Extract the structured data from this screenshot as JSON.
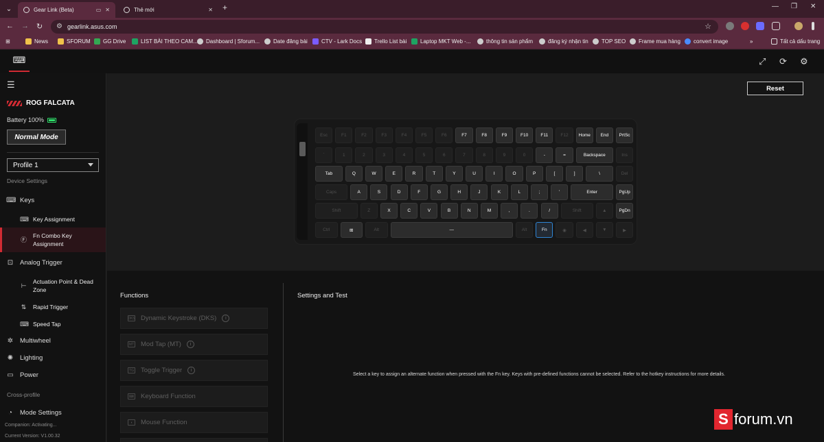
{
  "browser": {
    "tabs": [
      {
        "label": "Gear Link (Beta)",
        "active": true
      },
      {
        "label": "Thẻ mới",
        "active": false
      }
    ],
    "url": "gearlink.asus.com",
    "bookmarks": [
      {
        "label": "News",
        "color": "#f0c24a"
      },
      {
        "label": "SFORUM",
        "color": "#f0c24a"
      },
      {
        "label": "GG Drive",
        "color": "#34a853"
      },
      {
        "label": "LIST BÀI THEO CAM...",
        "color": "#1ea362"
      },
      {
        "label": "Dashboard | Sforum...",
        "color": "#cccccc"
      },
      {
        "label": "Date đăng bài",
        "color": "#cccccc"
      },
      {
        "label": "CTV - Lark Docs",
        "color": "#7b5cff"
      },
      {
        "label": "Trello List bài",
        "color": "#eeeeee"
      },
      {
        "label": "Laptop MKT Web -...",
        "color": "#1ea362"
      },
      {
        "label": "thông tin sản phẩm",
        "color": "#cccccc"
      },
      {
        "label": "đăng ký nhận tin",
        "color": "#cccccc"
      },
      {
        "label": "TOP SEO",
        "color": "#cccccc"
      },
      {
        "label": "Frame mua hàng",
        "color": "#cccccc"
      },
      {
        "label": "convert image",
        "color": "#4a8cff"
      }
    ],
    "all_bookmarks": "Tất cả dấu trang"
  },
  "sidebar": {
    "device_name": "ROG FALCATA",
    "battery": "Battery 100%",
    "mode": "Normal Mode",
    "profile": "Profile 1",
    "device_settings": "Device Settings",
    "keys": "Keys",
    "key_assignment": "Key Assignment",
    "fn_combo_1": "Fn Combo Key",
    "fn_combo_2": "Assignment",
    "analog_trigger": "Analog Trigger",
    "actuation_1": "Actuation Point & Dead",
    "actuation_2": "Zone",
    "rapid_trigger": "Rapid Trigger",
    "speed_tap": "Speed Tap",
    "multiwheel": "Multiwheel",
    "lighting": "Lighting",
    "power": "Power",
    "cross_profile": "Cross-profile",
    "mode_settings": "Mode Settings",
    "companion": "Companion: Activating...",
    "version": "Current Version: V1.00.32"
  },
  "main": {
    "reset": "Reset",
    "keyboard": {
      "row1": [
        {
          "l": "Esc",
          "on": false
        },
        {
          "l": "F1",
          "on": false
        },
        {
          "l": "F2",
          "on": false
        },
        {
          "l": "F3",
          "on": false
        },
        {
          "l": "F4",
          "on": false
        },
        {
          "l": "F5",
          "on": false
        },
        {
          "l": "F6",
          "on": false
        },
        {
          "l": "F7",
          "on": true
        },
        {
          "l": "F8",
          "on": true
        },
        {
          "l": "F9",
          "on": true
        },
        {
          "l": "F10",
          "on": true
        },
        {
          "l": "F11",
          "on": true
        },
        {
          "l": "F12",
          "on": false
        },
        {
          "l": "Home",
          "on": true
        },
        {
          "l": "End",
          "on": true
        },
        {
          "l": "PrtSc",
          "on": true
        }
      ],
      "row2": [
        {
          "l": "`",
          "on": false
        },
        {
          "l": "1",
          "on": false
        },
        {
          "l": "2",
          "on": false
        },
        {
          "l": "3",
          "on": false
        },
        {
          "l": "4",
          "on": false
        },
        {
          "l": "5",
          "on": false
        },
        {
          "l": "6",
          "on": false
        },
        {
          "l": "7",
          "on": false
        },
        {
          "l": "8",
          "on": false
        },
        {
          "l": "9",
          "on": false
        },
        {
          "l": "0",
          "on": false
        },
        {
          "l": "-",
          "on": true
        },
        {
          "l": "=",
          "on": true
        },
        {
          "l": "Backspace",
          "on": true
        },
        {
          "l": "Ins",
          "on": false
        }
      ],
      "row3": [
        {
          "l": "Tab",
          "on": true
        },
        {
          "l": "Q",
          "on": true
        },
        {
          "l": "W",
          "on": true
        },
        {
          "l": "E",
          "on": true
        },
        {
          "l": "R",
          "on": true
        },
        {
          "l": "T",
          "on": true
        },
        {
          "l": "Y",
          "on": true
        },
        {
          "l": "U",
          "on": true
        },
        {
          "l": "I",
          "on": true
        },
        {
          "l": "O",
          "on": true
        },
        {
          "l": "P",
          "on": true
        },
        {
          "l": "[",
          "on": true
        },
        {
          "l": "]",
          "on": true
        },
        {
          "l": "\\",
          "on": true
        },
        {
          "l": "Del",
          "on": false
        }
      ],
      "row4": [
        {
          "l": "Caps",
          "on": false
        },
        {
          "l": "A",
          "on": true
        },
        {
          "l": "S",
          "on": true
        },
        {
          "l": "D",
          "on": true
        },
        {
          "l": "F",
          "on": true
        },
        {
          "l": "G",
          "on": true
        },
        {
          "l": "H",
          "on": true
        },
        {
          "l": "J",
          "on": true
        },
        {
          "l": "K",
          "on": true
        },
        {
          "l": "L",
          "on": true
        },
        {
          "l": ";",
          "on": true
        },
        {
          "l": "'",
          "on": true
        },
        {
          "l": "Enter",
          "on": true
        },
        {
          "l": "PgUp",
          "on": true
        }
      ],
      "row5": [
        {
          "l": "Shift",
          "on": false
        },
        {
          "l": "Z",
          "on": false
        },
        {
          "l": "X",
          "on": true
        },
        {
          "l": "C",
          "on": true
        },
        {
          "l": "V",
          "on": true
        },
        {
          "l": "B",
          "on": true
        },
        {
          "l": "N",
          "on": true
        },
        {
          "l": "M",
          "on": true
        },
        {
          "l": ",",
          "on": true
        },
        {
          "l": ".",
          "on": true
        },
        {
          "l": "/",
          "on": true
        },
        {
          "l": "Shift",
          "on": false
        },
        {
          "l": "▲",
          "on": false
        },
        {
          "l": "PgDn",
          "on": true
        }
      ],
      "row6": [
        {
          "l": "Ctrl",
          "on": false
        },
        {
          "l": "⊞",
          "on": true
        },
        {
          "l": "Alt",
          "on": false
        },
        {
          "l": "—",
          "on": true
        },
        {
          "l": "Alt",
          "on": false
        },
        {
          "l": "Fn",
          "on": true,
          "fn": true
        },
        {
          "l": "◉",
          "on": false
        },
        {
          "l": "◀",
          "on": false
        },
        {
          "l": "▼",
          "on": false
        },
        {
          "l": "▶",
          "on": false
        }
      ]
    },
    "functions_title": "Functions",
    "functions": [
      {
        "label": "Dynamic Keystroke (DKS)",
        "info": true
      },
      {
        "label": "Mod Tap (MT)",
        "info": true
      },
      {
        "label": "Toggle Trigger",
        "info": true
      },
      {
        "label": "Keyboard Function",
        "info": false
      },
      {
        "label": "Mouse Function",
        "info": false
      }
    ],
    "settings_title": "Settings and Test",
    "hint": "Select a key to assign an alternate function when pressed with the Fn key. Keys with pre-defined functions cannot be selected. Refer to the hotkey instructions for more details."
  },
  "watermark": {
    "s": "S",
    "text": "forum.vn"
  }
}
